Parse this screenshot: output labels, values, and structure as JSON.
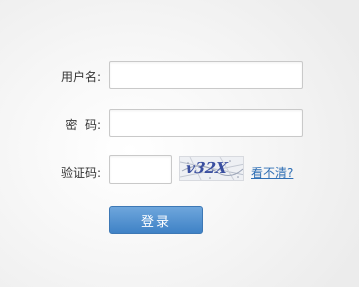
{
  "form": {
    "username": {
      "label": "用户名:",
      "value": "",
      "placeholder": ""
    },
    "password": {
      "label": "密  码:",
      "value": "",
      "placeholder": ""
    },
    "captcha": {
      "label": "验证码:",
      "value": "",
      "placeholder": "",
      "image_text": "v32X",
      "refresh_link": "看不清?"
    },
    "submit_label": "登录"
  },
  "colors": {
    "link": "#2f6fb5",
    "button_top": "#6ea6dc",
    "button_bottom": "#3f82c6",
    "captcha_text": "#3a4fa0"
  },
  "icons": {
    "captcha": "captcha-image"
  }
}
